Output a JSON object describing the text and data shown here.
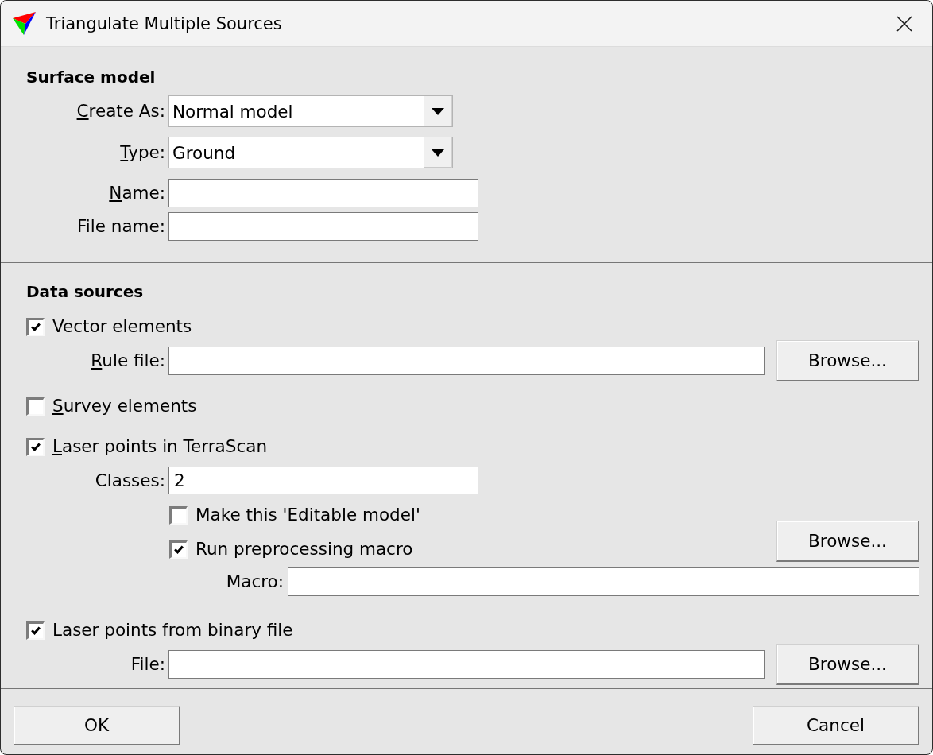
{
  "window": {
    "title": "Triangulate Multiple Sources"
  },
  "surface_model": {
    "heading": "Surface model",
    "dropdowns": [
      {
        "label": "Create As:",
        "mnemonic": true,
        "value": "Normal model"
      },
      {
        "label": "Type:",
        "mnemonic": true,
        "value": "Ground"
      }
    ],
    "fields": [
      {
        "label": "Name:",
        "mnemonic": true
      },
      {
        "label": "File name:",
        "mnemonic": false
      }
    ]
  },
  "data_sources": {
    "heading": "Data sources",
    "rows": [
      {
        "kind": "checkbox",
        "label": "Vector elements",
        "mnemonic": false,
        "checked": true
      },
      {
        "kind": "file",
        "label": "Rule file:",
        "mnemonic": true,
        "button": "Browse..."
      },
      {
        "kind": "checkbox",
        "label": "Survey elements",
        "mnemonic": true,
        "checked": false
      },
      {
        "kind": "checkbox",
        "label": "Laser points in TerraScan",
        "mnemonic": true,
        "checked": true
      },
      {
        "kind": "field",
        "label": "Classes:",
        "mnemonic": false,
        "value": "2"
      },
      {
        "kind": "options",
        "options": [
          {
            "label": "Make this 'Editable model'",
            "mnemonic": false,
            "checked": false
          },
          {
            "label": "Run preprocessing macro",
            "mnemonic": false,
            "checked": true
          }
        ],
        "button": "Browse..."
      },
      {
        "kind": "macro",
        "label": "Macro:",
        "mnemonic": false
      },
      {
        "kind": "checkbox",
        "label": "Laser points from binary file",
        "mnemonic": false,
        "checked": true
      },
      {
        "kind": "file",
        "label": "File:",
        "mnemonic": false,
        "button": "Browse..."
      }
    ]
  },
  "buttons": [
    {
      "label": "OK"
    },
    {
      "label": "Cancel"
    }
  ]
}
